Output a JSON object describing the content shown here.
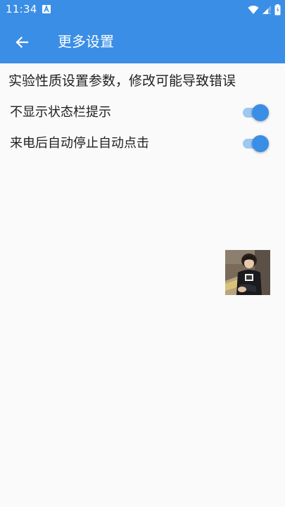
{
  "status_bar": {
    "time": "11:34",
    "app_indicator_letter": "A",
    "icons": [
      "wifi-icon",
      "signal-icon",
      "battery-icon"
    ]
  },
  "app_bar": {
    "title": "更多设置",
    "back_icon": "arrow-left-icon"
  },
  "content": {
    "warning": "实验性质设置参数，修改可能导致错误",
    "settings": [
      {
        "label": "不显示状态栏提示",
        "enabled": true
      },
      {
        "label": "来电后自动停止自动点击",
        "enabled": true
      }
    ]
  },
  "floating_window": {
    "content": "photo thumbnail"
  },
  "colors": {
    "primary": "#3a8ee6",
    "switch_track_on": "#9cc8f2",
    "background": "#fafafa",
    "text": "#212121"
  }
}
